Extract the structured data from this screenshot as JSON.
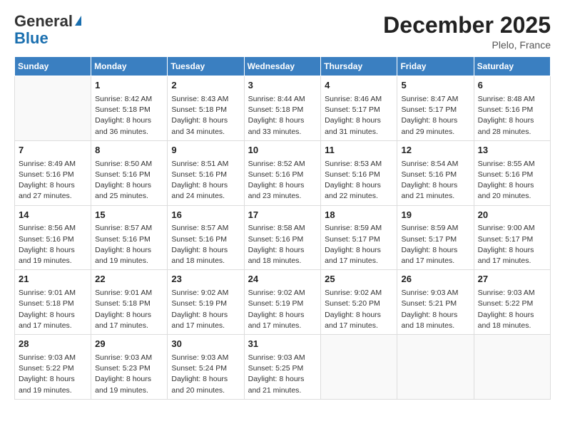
{
  "header": {
    "logo_general": "General",
    "logo_blue": "Blue",
    "month_title": "December 2025",
    "location": "Plelo, France"
  },
  "days_of_week": [
    "Sunday",
    "Monday",
    "Tuesday",
    "Wednesday",
    "Thursday",
    "Friday",
    "Saturday"
  ],
  "weeks": [
    [
      {
        "day": "",
        "info": ""
      },
      {
        "day": "1",
        "info": "Sunrise: 8:42 AM\nSunset: 5:18 PM\nDaylight: 8 hours\nand 36 minutes."
      },
      {
        "day": "2",
        "info": "Sunrise: 8:43 AM\nSunset: 5:18 PM\nDaylight: 8 hours\nand 34 minutes."
      },
      {
        "day": "3",
        "info": "Sunrise: 8:44 AM\nSunset: 5:18 PM\nDaylight: 8 hours\nand 33 minutes."
      },
      {
        "day": "4",
        "info": "Sunrise: 8:46 AM\nSunset: 5:17 PM\nDaylight: 8 hours\nand 31 minutes."
      },
      {
        "day": "5",
        "info": "Sunrise: 8:47 AM\nSunset: 5:17 PM\nDaylight: 8 hours\nand 29 minutes."
      },
      {
        "day": "6",
        "info": "Sunrise: 8:48 AM\nSunset: 5:16 PM\nDaylight: 8 hours\nand 28 minutes."
      }
    ],
    [
      {
        "day": "7",
        "info": "Sunrise: 8:49 AM\nSunset: 5:16 PM\nDaylight: 8 hours\nand 27 minutes."
      },
      {
        "day": "8",
        "info": "Sunrise: 8:50 AM\nSunset: 5:16 PM\nDaylight: 8 hours\nand 25 minutes."
      },
      {
        "day": "9",
        "info": "Sunrise: 8:51 AM\nSunset: 5:16 PM\nDaylight: 8 hours\nand 24 minutes."
      },
      {
        "day": "10",
        "info": "Sunrise: 8:52 AM\nSunset: 5:16 PM\nDaylight: 8 hours\nand 23 minutes."
      },
      {
        "day": "11",
        "info": "Sunrise: 8:53 AM\nSunset: 5:16 PM\nDaylight: 8 hours\nand 22 minutes."
      },
      {
        "day": "12",
        "info": "Sunrise: 8:54 AM\nSunset: 5:16 PM\nDaylight: 8 hours\nand 21 minutes."
      },
      {
        "day": "13",
        "info": "Sunrise: 8:55 AM\nSunset: 5:16 PM\nDaylight: 8 hours\nand 20 minutes."
      }
    ],
    [
      {
        "day": "14",
        "info": "Sunrise: 8:56 AM\nSunset: 5:16 PM\nDaylight: 8 hours\nand 19 minutes."
      },
      {
        "day": "15",
        "info": "Sunrise: 8:57 AM\nSunset: 5:16 PM\nDaylight: 8 hours\nand 19 minutes."
      },
      {
        "day": "16",
        "info": "Sunrise: 8:57 AM\nSunset: 5:16 PM\nDaylight: 8 hours\nand 18 minutes."
      },
      {
        "day": "17",
        "info": "Sunrise: 8:58 AM\nSunset: 5:16 PM\nDaylight: 8 hours\nand 18 minutes."
      },
      {
        "day": "18",
        "info": "Sunrise: 8:59 AM\nSunset: 5:17 PM\nDaylight: 8 hours\nand 17 minutes."
      },
      {
        "day": "19",
        "info": "Sunrise: 8:59 AM\nSunset: 5:17 PM\nDaylight: 8 hours\nand 17 minutes."
      },
      {
        "day": "20",
        "info": "Sunrise: 9:00 AM\nSunset: 5:17 PM\nDaylight: 8 hours\nand 17 minutes."
      }
    ],
    [
      {
        "day": "21",
        "info": "Sunrise: 9:01 AM\nSunset: 5:18 PM\nDaylight: 8 hours\nand 17 minutes."
      },
      {
        "day": "22",
        "info": "Sunrise: 9:01 AM\nSunset: 5:18 PM\nDaylight: 8 hours\nand 17 minutes."
      },
      {
        "day": "23",
        "info": "Sunrise: 9:02 AM\nSunset: 5:19 PM\nDaylight: 8 hours\nand 17 minutes."
      },
      {
        "day": "24",
        "info": "Sunrise: 9:02 AM\nSunset: 5:19 PM\nDaylight: 8 hours\nand 17 minutes."
      },
      {
        "day": "25",
        "info": "Sunrise: 9:02 AM\nSunset: 5:20 PM\nDaylight: 8 hours\nand 17 minutes."
      },
      {
        "day": "26",
        "info": "Sunrise: 9:03 AM\nSunset: 5:21 PM\nDaylight: 8 hours\nand 18 minutes."
      },
      {
        "day": "27",
        "info": "Sunrise: 9:03 AM\nSunset: 5:22 PM\nDaylight: 8 hours\nand 18 minutes."
      }
    ],
    [
      {
        "day": "28",
        "info": "Sunrise: 9:03 AM\nSunset: 5:22 PM\nDaylight: 8 hours\nand 19 minutes."
      },
      {
        "day": "29",
        "info": "Sunrise: 9:03 AM\nSunset: 5:23 PM\nDaylight: 8 hours\nand 19 minutes."
      },
      {
        "day": "30",
        "info": "Sunrise: 9:03 AM\nSunset: 5:24 PM\nDaylight: 8 hours\nand 20 minutes."
      },
      {
        "day": "31",
        "info": "Sunrise: 9:03 AM\nSunset: 5:25 PM\nDaylight: 8 hours\nand 21 minutes."
      },
      {
        "day": "",
        "info": ""
      },
      {
        "day": "",
        "info": ""
      },
      {
        "day": "",
        "info": ""
      }
    ]
  ]
}
